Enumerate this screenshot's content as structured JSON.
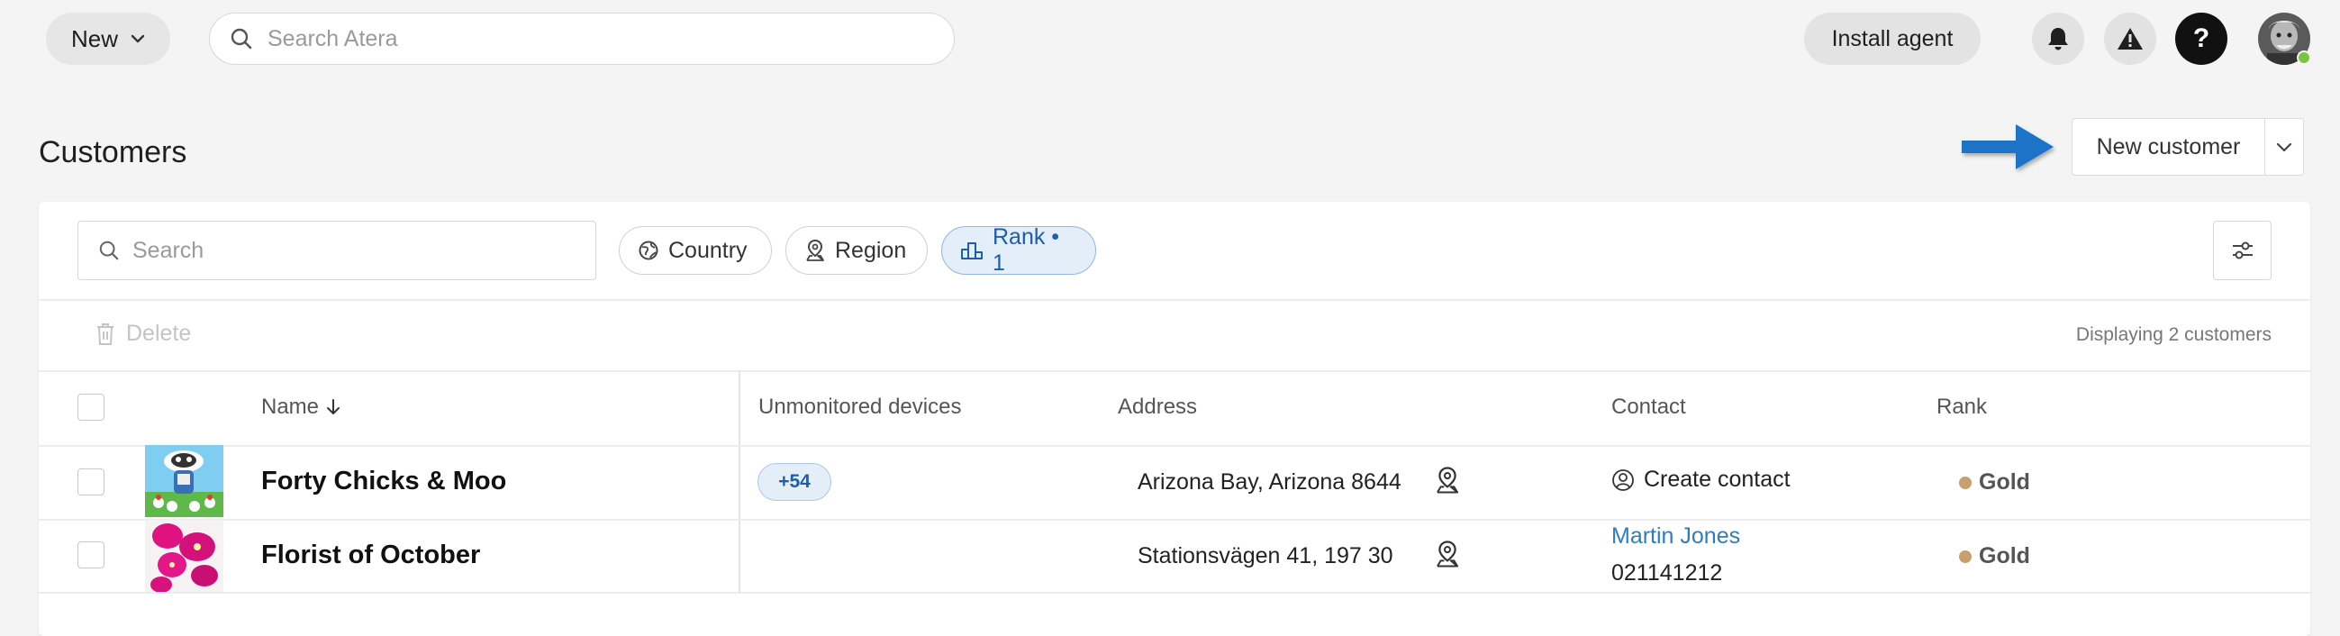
{
  "topbar": {
    "new_label": "New",
    "search_placeholder": "Search Atera",
    "install_agent_label": "Install agent",
    "help_label": "?"
  },
  "page": {
    "title": "Customers",
    "new_customer_label": "New customer"
  },
  "filters": {
    "search_placeholder": "Search",
    "chips": [
      {
        "label": "Country",
        "icon": "globe-icon"
      },
      {
        "label": "Region",
        "icon": "map-pin-icon"
      },
      {
        "label": "Rank • 1",
        "icon": "podium-icon",
        "active": true
      }
    ]
  },
  "toolbar": {
    "delete_label": "Delete",
    "displaying": "Displaying 2 customers"
  },
  "table": {
    "columns": [
      "Name",
      "Unmonitored devices",
      "Address",
      "Contact",
      "Rank"
    ],
    "rows": [
      {
        "name": "Forty Chicks & Moo",
        "unmonitored": "+54",
        "address": "Arizona Bay, Arizona 8644",
        "contact_action": "Create contact",
        "rank": "Gold"
      },
      {
        "name": "Florist of October",
        "unmonitored": "",
        "address": "Stationsvägen 41, 197 30",
        "contact_name": "Martin Jones",
        "contact_phone": "021141212",
        "rank": "Gold"
      }
    ]
  },
  "colors": {
    "accent": "#1b5eab",
    "link": "#2d7dc2",
    "gold": "#c8a06b",
    "online": "#7cc243",
    "hint_arrow": "#1a73c7"
  }
}
